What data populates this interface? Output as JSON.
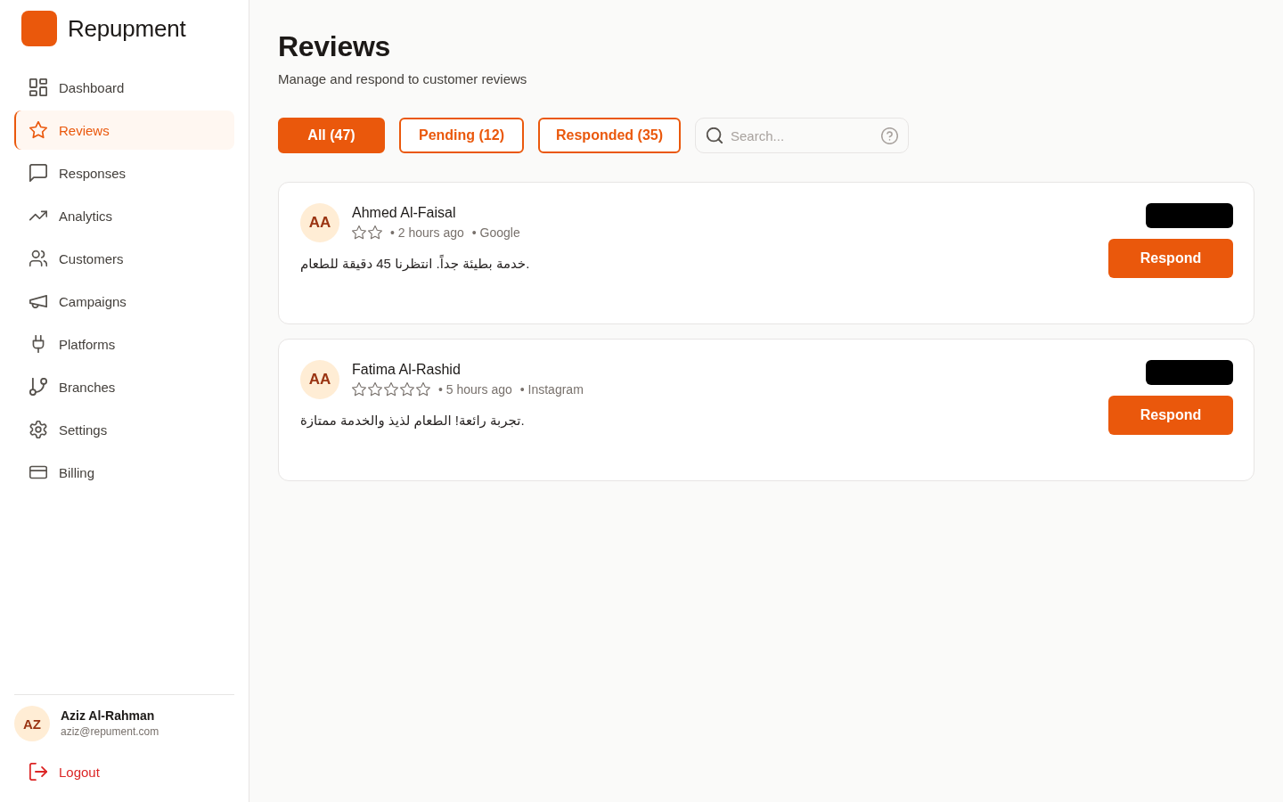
{
  "sidebar": {
    "brand": "Repupment",
    "nav_items": [
      {
        "label": "Dashboard",
        "selected": false
      },
      {
        "label": "Reviews",
        "selected": true
      },
      {
        "label": "Responses",
        "selected": false
      },
      {
        "label": "Analytics",
        "selected": false
      },
      {
        "label": "Customers",
        "selected": false
      },
      {
        "label": "Campaigns",
        "selected": false
      },
      {
        "label": "Platforms",
        "selected": false
      },
      {
        "label": "Branches",
        "selected": false
      },
      {
        "label": "Settings",
        "selected": false
      },
      {
        "label": "Billing",
        "selected": false
      }
    ],
    "user": {
      "initials": "AZ",
      "name": "Aziz Al-Rahman",
      "email": "aziz@repument.com"
    },
    "logout": "Logout"
  },
  "header": {
    "title": "Reviews",
    "subtitle": "Manage and respond to customer reviews"
  },
  "filter_tabs": [
    {
      "label": "All (47)",
      "selected": true
    },
    {
      "label": "Pending (12)",
      "selected": false
    },
    {
      "label": "Responded (35)",
      "selected": false
    }
  ],
  "search": {
    "placeholder": "Search..."
  },
  "reviews": [
    {
      "initials": "AA",
      "name": "Ahmed Al-Faisal",
      "rating_stars": [
        {
          "filled": false
        },
        {
          "filled": false
        }
      ],
      "time": "• 2 hours ago",
      "platform": "• Google",
      "text": "خدمة بطيئة جداً. انتظرنا 45 دقيقة للطعام.",
      "action": "Respond"
    },
    {
      "initials": "AA",
      "name": "Fatima Al-Rashid",
      "rating_stars": [
        {
          "filled": false
        },
        {
          "filled": false
        },
        {
          "filled": false
        },
        {
          "filled": false
        },
        {
          "filled": false
        }
      ],
      "time": "• 5 hours ago",
      "platform": "• Instagram",
      "text": "تجربة رائعة! الطعام لذيذ والخدمة ممتازة.",
      "action": "Respond"
    }
  ]
}
